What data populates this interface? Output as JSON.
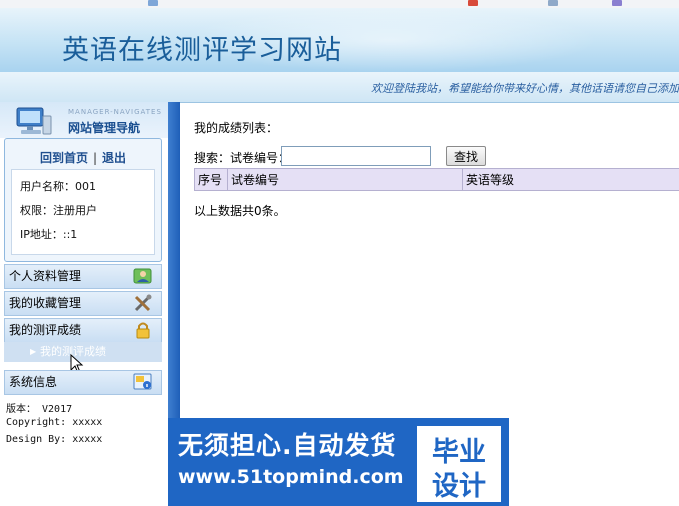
{
  "site": {
    "title": "英语在线测评学习网站",
    "welcome": "欢迎登陆我站，希望能给你带来好心情，其他话语请您自己添加"
  },
  "sidebar": {
    "nav_subtitle": "MANAGER-NAVIGATES",
    "nav_title": "网站管理导航",
    "home_link": "回到首页",
    "separator": "|",
    "logout_link": "退出",
    "user": {
      "username": "用户名称：001",
      "permission": "权限：注册用户",
      "ip": "IP地址：::1"
    },
    "menu": [
      {
        "label": "个人资料管理",
        "icon": "user-icon"
      },
      {
        "label": "我的收藏管理",
        "icon": "tools-icon"
      },
      {
        "label": "我的测评成绩",
        "icon": "lock-icon"
      }
    ],
    "submenu_active": "我的测评成绩",
    "system": {
      "label": "系统信息",
      "icon": "info-icon",
      "version": "版本：  V2017",
      "copyright": "Copyright: xxxxx",
      "design": "Design By:  xxxxx"
    }
  },
  "main": {
    "title": "我的成绩列表：",
    "search_label": "搜索：试卷编号：",
    "search_value": "",
    "search_button": "查找",
    "table_headers": [
      "序号",
      "试卷编号",
      "英语等级"
    ],
    "record_count": "以上数据共0条。"
  },
  "watermark": {
    "line1": "无须担心.自动发货",
    "line2": "www.51topmind.com",
    "right_top": "毕业",
    "right_bottom": "设计"
  },
  "colors": {
    "title_blue": "#1a5e9a",
    "sidebar_edge": "#1f5fb8",
    "table_header": "#e5e0f5",
    "watermark_blue": "#1f66c4"
  }
}
